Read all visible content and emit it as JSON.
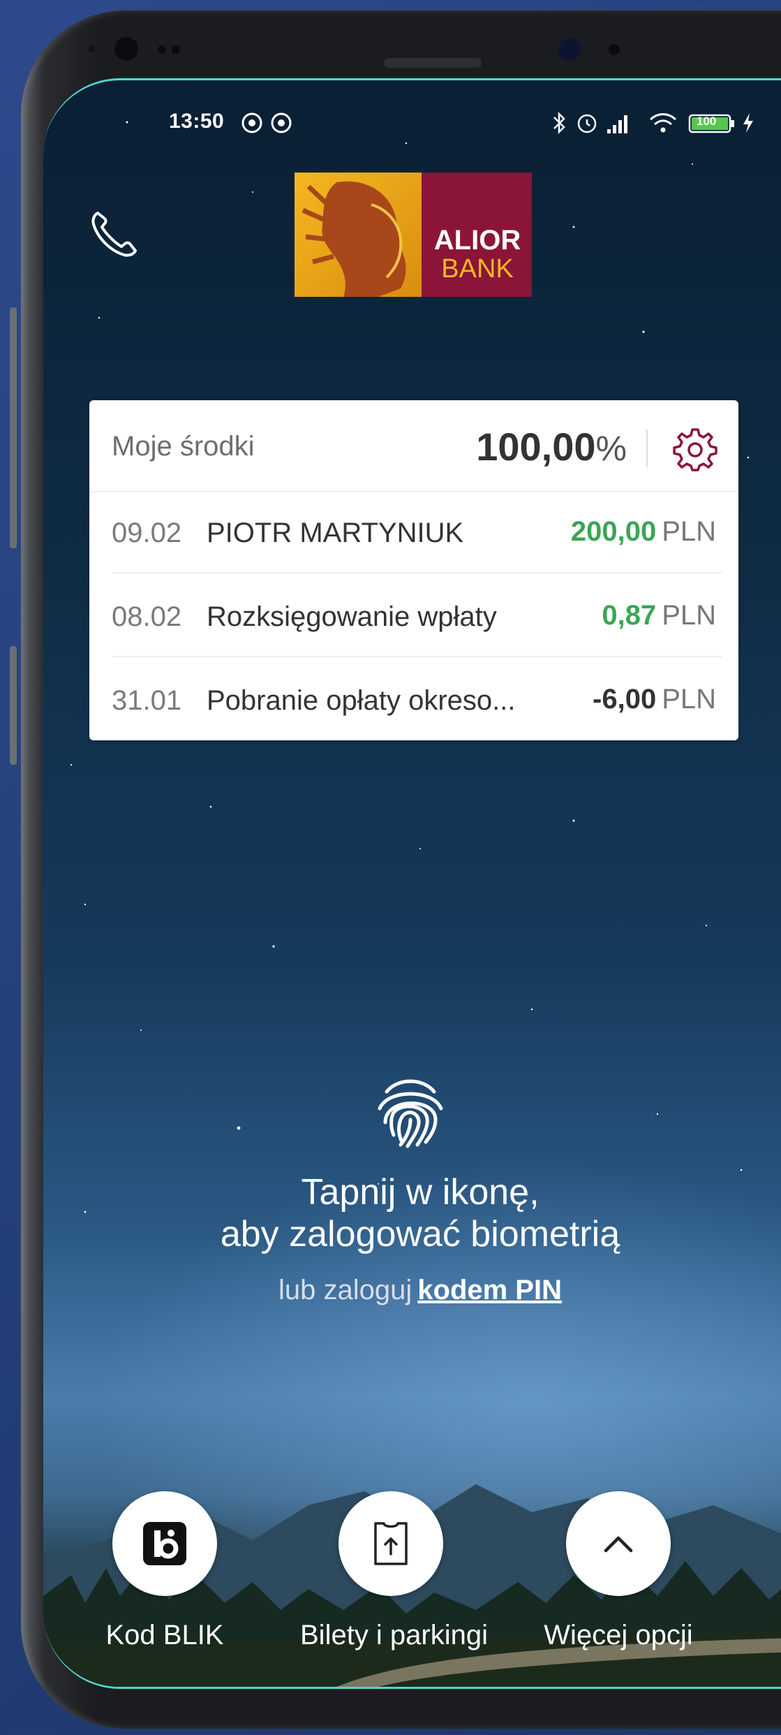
{
  "status_bar": {
    "time": "13:50",
    "battery": "100"
  },
  "header": {
    "phone_icon": "phone-icon",
    "logo": {
      "line1": "ALIOR",
      "line2": "BANK"
    }
  },
  "balance_card": {
    "title": "Moje środki",
    "percent_value": "100,00",
    "percent_sign": "%",
    "settings_icon": "gear-icon",
    "transactions": [
      {
        "date": "09.02",
        "description": "PIOTR MARTYNIUK",
        "amount": "200,00",
        "currency": "PLN",
        "type": "positive"
      },
      {
        "date": "08.02",
        "description": "Rozksięgowanie wpłaty",
        "amount": "0,87",
        "currency": "PLN",
        "type": "positive"
      },
      {
        "date": "31.01",
        "description": "Pobranie opłaty okreso...",
        "amount": "-6,00",
        "currency": "PLN",
        "type": "negative"
      }
    ]
  },
  "login": {
    "fingerprint_icon": "fingerprint-icon",
    "line1": "Tapnij w ikonę,",
    "line2": "aby zalogować biometrią",
    "alt_prefix": "lub zaloguj",
    "pin_link": "kodem PIN"
  },
  "actions": [
    {
      "label": "Kod BLIK",
      "icon": "blik-icon"
    },
    {
      "label": "Bilety i parkingi",
      "icon": "ticket-icon"
    },
    {
      "label": "Więcej opcji",
      "icon": "chevron-up-icon"
    }
  ],
  "colors": {
    "brand": "#8b1538",
    "brand_gold": "#e0a11b",
    "positive": "#3aa655",
    "accent_border": "#4fd8cf"
  }
}
